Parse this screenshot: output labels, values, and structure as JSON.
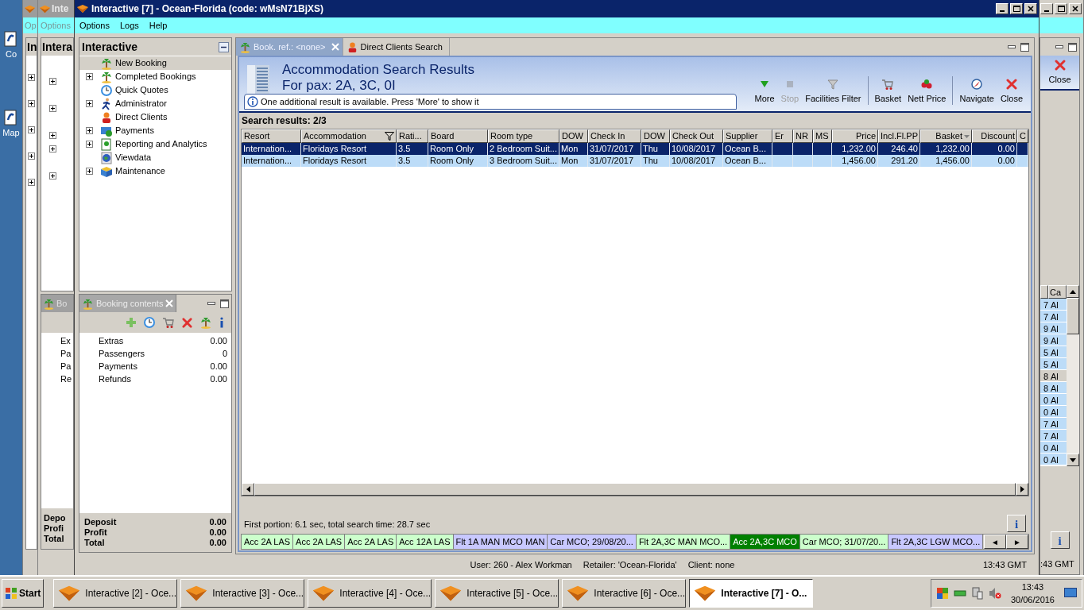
{
  "desktop": {
    "icons": [
      {
        "label": "Co"
      },
      {
        "label": "Map"
      }
    ]
  },
  "back_window_left": {
    "menu": "Op",
    "panel_title": "In"
  },
  "back_window_middle": {
    "title": "Inte",
    "menu": "Options",
    "panel_title": "Intera",
    "tab": "Bo",
    "rows": [
      "Ex",
      "Pa",
      "Pa",
      "Re"
    ],
    "totals": [
      "Depo",
      "Profi",
      "Total"
    ]
  },
  "window": {
    "title": "Interactive [7] - Ocean-Florida (code: wMsN71BjXS)"
  },
  "menu": [
    "Options",
    "Logs",
    "Help"
  ],
  "navigator": {
    "title": "Interactive",
    "items": [
      {
        "label": "New Booking",
        "expandable": false,
        "selected": true
      },
      {
        "label": "Completed Bookings",
        "expandable": true,
        "selected": false
      },
      {
        "label": "Quick Quotes",
        "expandable": false,
        "selected": false
      },
      {
        "label": "Administrator",
        "expandable": true,
        "selected": false
      },
      {
        "label": "Direct Clients",
        "expandable": false,
        "selected": false
      },
      {
        "label": "Payments",
        "expandable": true,
        "selected": false
      },
      {
        "label": "Reporting and Analytics",
        "expandable": true,
        "selected": false
      },
      {
        "label": "Viewdata",
        "expandable": false,
        "selected": false
      },
      {
        "label": "Maintenance",
        "expandable": true,
        "selected": false
      }
    ]
  },
  "booking_contents": {
    "tab": "Booking contents",
    "rows": [
      {
        "label": "Extras",
        "value": "0.00"
      },
      {
        "label": "Passengers",
        "value": "0"
      },
      {
        "label": "Payments",
        "value": "0.00"
      },
      {
        "label": "Refunds",
        "value": "0.00"
      }
    ],
    "totals": [
      {
        "label": "Deposit",
        "value": "0.00"
      },
      {
        "label": "Profit",
        "value": "0.00"
      },
      {
        "label": "Total",
        "value": "0.00"
      }
    ]
  },
  "editor": {
    "tabs": [
      {
        "label": "Book. ref.: <none>",
        "selected": true,
        "closable": true
      },
      {
        "label": "Direct Clients Search",
        "selected": false,
        "closable": false
      }
    ],
    "heading": "Accommodation Search Results",
    "subheading": "For pax: 2A, 3C, 0I",
    "notice": "One additional result is available. Press 'More' to show it",
    "toolbar_groups": [
      [
        {
          "label": "More",
          "disabled": false
        },
        {
          "label": "Stop",
          "disabled": true
        },
        {
          "label": "Facilities Filter",
          "disabled": false
        }
      ],
      [
        {
          "label": "Basket",
          "disabled": false
        },
        {
          "label": "Nett Price",
          "disabled": false
        }
      ],
      [
        {
          "label": "Navigate",
          "disabled": false
        },
        {
          "label": "Close",
          "disabled": false
        }
      ]
    ],
    "results_label": "Search results: 2/3",
    "table": {
      "columns": [
        {
          "label": "Resort"
        },
        {
          "label": "Accommodation",
          "filtered": true
        },
        {
          "label": "Rati..."
        },
        {
          "label": "Board"
        },
        {
          "label": "Room type"
        },
        {
          "label": "DOW"
        },
        {
          "label": "Check In"
        },
        {
          "label": "DOW"
        },
        {
          "label": "Check Out"
        },
        {
          "label": "Supplier"
        },
        {
          "label": "Er"
        },
        {
          "label": "NR"
        },
        {
          "label": "MS"
        },
        {
          "label": "Price"
        },
        {
          "label": "Incl.Fl.PP"
        },
        {
          "label": "Basket",
          "sorted": true
        },
        {
          "label": "Discount"
        },
        {
          "label": "C"
        }
      ],
      "rows": [
        {
          "selected": true,
          "cells": [
            "Internation...",
            "Floridays Resort",
            "3.5",
            "Room Only",
            "2 Bedroom Suit...",
            "Mon",
            "31/07/2017",
            "Thu",
            "10/08/2017",
            "Ocean B...",
            null,
            null,
            null,
            "1,232.00",
            "246.40",
            "1,232.00",
            "0.00",
            null
          ]
        },
        {
          "selected": false,
          "cells": [
            "Internation...",
            "Floridays Resort",
            "3.5",
            "Room Only",
            "3 Bedroom Suit...",
            "Mon",
            "31/07/2017",
            "Thu",
            "10/08/2017",
            "Ocean B...",
            null,
            null,
            null,
            "1,456.00",
            "291.20",
            "1,456.00",
            "0.00",
            null
          ]
        }
      ]
    },
    "timing": "First portion: 6.1 sec, total search time: 28.7 sec",
    "info_label": "i",
    "components": [
      {
        "label": "Acc 2A LAS",
        "color": "#ccffcc",
        "selected": false
      },
      {
        "label": "Acc 2A LAS",
        "color": "#ccffcc",
        "selected": false
      },
      {
        "label": "Acc 2A LAS",
        "color": "#ccffcc",
        "selected": false
      },
      {
        "label": "Acc 12A LAS",
        "color": "#ccffcc",
        "selected": false
      },
      {
        "label": "Flt 1A MAN MCO MAN",
        "color": "#c8c8ff",
        "selected": false
      },
      {
        "label": "Car MCO; 29/08/20...",
        "color": "#c8c8ff",
        "selected": false
      },
      {
        "label": "Flt 2A,3C MAN MCO...",
        "color": "#ccffcc",
        "selected": false
      },
      {
        "label": "Acc 2A,3C MCO",
        "color": "#008000",
        "selected": true
      },
      {
        "label": "Car MCO; 31/07/20...",
        "color": "#ccffcc",
        "selected": false
      },
      {
        "label": "Flt 2A,3C LGW MCO...",
        "color": "#c8c8ff",
        "selected": false
      }
    ],
    "nav_buttons": [
      "◄",
      "►"
    ]
  },
  "status": {
    "user": "User: 260 - Alex Workman",
    "retailer": "Retailer: 'Ocean-Florida'",
    "client": "Client: none",
    "time": "13:43 GMT"
  },
  "back_window_right": {
    "toolbar_label": "Close",
    "column": "Ca",
    "rows": [
      {
        "cell_1": "7",
        "cell_2": "Al",
        "selected": false
      },
      {
        "cell_1": "7",
        "cell_2": "Al",
        "selected": false
      },
      {
        "cell_1": "9",
        "cell_2": "Al",
        "selected": false
      },
      {
        "cell_1": "9",
        "cell_2": "Al",
        "selected": false
      },
      {
        "cell_1": "5",
        "cell_2": "Al",
        "selected": false
      },
      {
        "cell_1": "5",
        "cell_2": "Al",
        "selected": false
      },
      {
        "cell_1": "8",
        "cell_2": "Al",
        "selected": true
      },
      {
        "cell_1": "8",
        "cell_2": "Al",
        "selected": false
      },
      {
        "cell_1": "0",
        "cell_2": "Al",
        "selected": false
      },
      {
        "cell_1": "0",
        "cell_2": "Al",
        "selected": false
      },
      {
        "cell_1": "7",
        "cell_2": "Al",
        "selected": false
      },
      {
        "cell_1": "7",
        "cell_2": "Al",
        "selected": false
      },
      {
        "cell_1": "0",
        "cell_2": "Al",
        "selected": false
      },
      {
        "cell_1": "0",
        "cell_2": "Al",
        "selected": false
      }
    ],
    "info_label": "i",
    "time": ":43 GMT"
  },
  "taskbar": {
    "start": "Start",
    "tasks": [
      {
        "label": "Interactive [2] - Oce...",
        "selected": false
      },
      {
        "label": "Interactive [3] - Oce...",
        "selected": false
      },
      {
        "label": "Interactive [4] - Oce...",
        "selected": false
      },
      {
        "label": "Interactive [5] - Oce...",
        "selected": false
      },
      {
        "label": "Interactive [6] - Oce...",
        "selected": false
      },
      {
        "label": "Interactive [7] - O...",
        "selected": true
      }
    ],
    "time": "13:43",
    "date": "30/06/2016"
  }
}
